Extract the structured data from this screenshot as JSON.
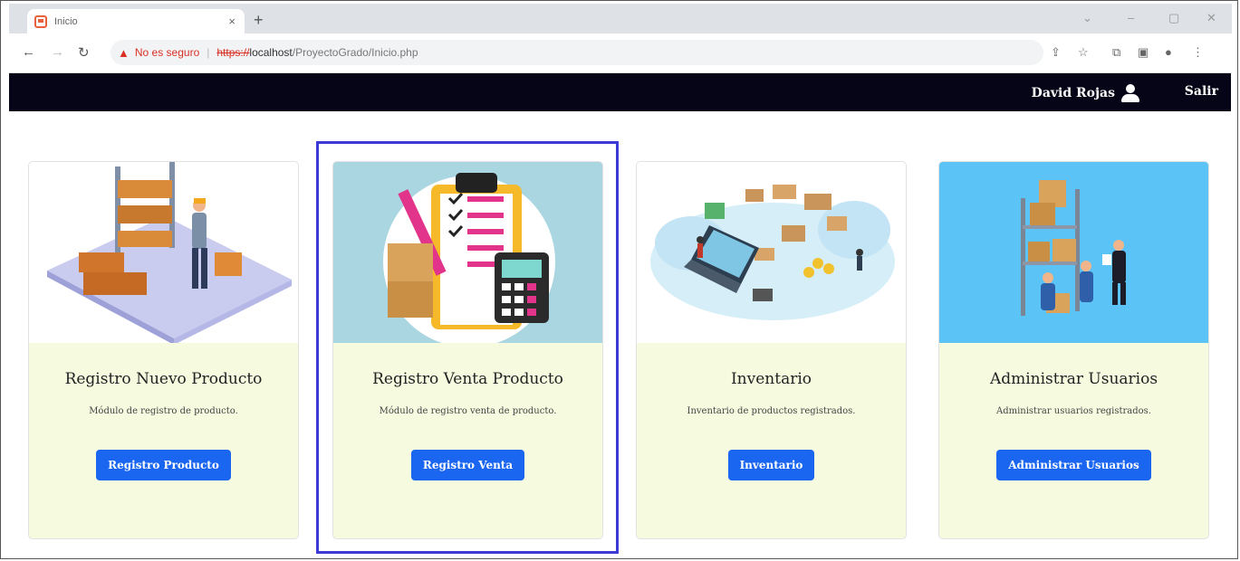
{
  "browser": {
    "tab_title": "Inicio",
    "tab_close": "×",
    "new_tab": "+",
    "security_label": "No es seguro",
    "url_protocol": "https://",
    "url_host": "localhost",
    "url_path": "/ProyectoGrado/Inicio.php"
  },
  "navbar": {
    "user_name": "David Rojas",
    "exit_label": "Salir"
  },
  "cards": [
    {
      "title": "Registro Nuevo Producto",
      "description": "Módulo de registro de producto.",
      "button": "Registro Producto",
      "image_bg": "#ffffff"
    },
    {
      "title": "Registro Venta Producto",
      "description": "Módulo de registro venta de producto.",
      "button": "Registro Venta",
      "image_bg": "#a9d6e0"
    },
    {
      "title": "Inventario",
      "description": "Inventario de productos registrados.",
      "button": "Inventario",
      "image_bg": "#ffffff"
    },
    {
      "title": "Administrar Usuarios",
      "description": "Administrar usuarios registrados.",
      "button": "Administrar Usuarios",
      "image_bg": "#5bc3f5"
    }
  ],
  "colors": {
    "navbar_bg": "#050517",
    "button_bg": "#1a66f0",
    "card_body_bg": "#f6fbdf",
    "highlight_border": "#3b3bd4"
  }
}
